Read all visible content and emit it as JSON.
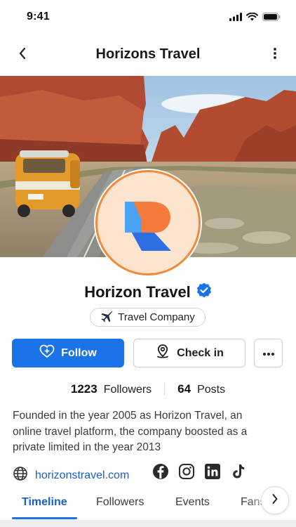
{
  "status_bar": {
    "time": "9:41"
  },
  "nav": {
    "title": "Horizons Travel"
  },
  "profile": {
    "name": "Horizon Travel",
    "verified": true,
    "category": "Travel Company",
    "category_icon": "airplane-icon"
  },
  "actions": {
    "follow_label": "Follow",
    "checkin_label": "Check in"
  },
  "stats": {
    "followers_count": "1223",
    "followers_label": "Followers",
    "posts_count": "64",
    "posts_label": "Posts"
  },
  "bio": {
    "line1": "Founded in the year 2005 as Horizon Travel, an",
    "line2": "online travel platform, the company boosted as a",
    "line3": "private limited in the year 2013"
  },
  "links": {
    "website": "horizonstravel.com",
    "socials": [
      "facebook-icon",
      "instagram-icon",
      "linkedin-icon",
      "tiktok-icon"
    ]
  },
  "tabs": [
    {
      "label": "Timeline",
      "active": true
    },
    {
      "label": "Followers",
      "active": false
    },
    {
      "label": "Events",
      "active": false
    },
    {
      "label": "Fans",
      "active": false
    }
  ],
  "colors": {
    "primary": "#1a73e8",
    "link": "#1a5fc7",
    "avatar_ring": "#f08a3a",
    "avatar_bg": "#fde4cf",
    "logo_orange": "#f47b3b",
    "logo_blue_light": "#4aa3f5",
    "logo_blue_dark": "#2f6fe4"
  }
}
